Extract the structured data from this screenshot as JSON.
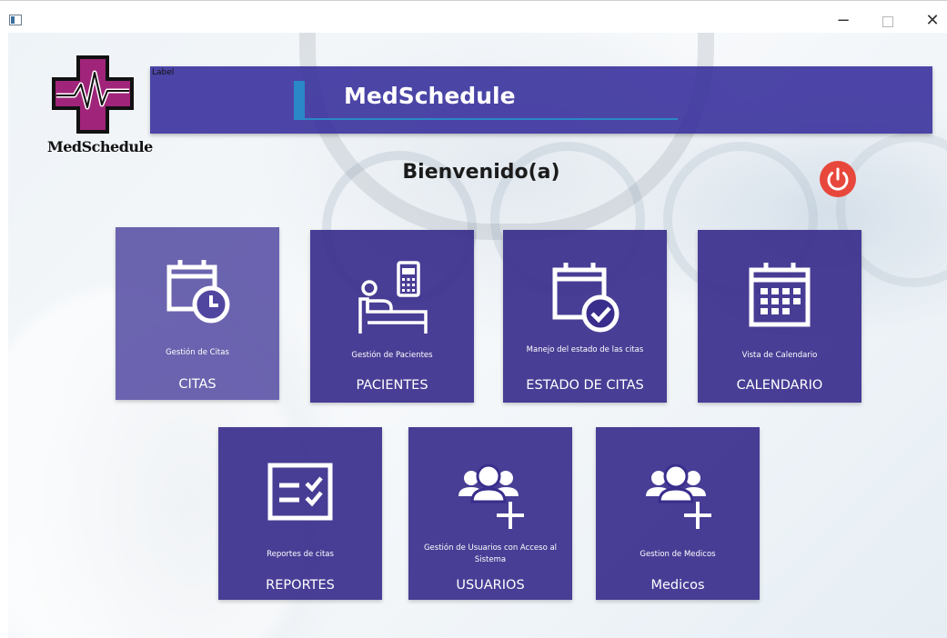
{
  "window": {
    "min_glyph": "−",
    "close_glyph": "✕"
  },
  "logo": {
    "text": "MedSchedule",
    "icon": "medical-cross-heartbeat-icon",
    "colors": {
      "outline": "#111111",
      "fill": "#a0247a"
    }
  },
  "header": {
    "label": "Label",
    "title": "MedSchedule"
  },
  "welcome": "Bienvenido(a)",
  "power_button": {
    "icon": "power-icon",
    "color": "#e8473c"
  },
  "tiles": [
    {
      "icon": "calendar-clock-icon",
      "description": "Gestión de Citas",
      "name": "CITAS"
    },
    {
      "icon": "patient-bed-icon",
      "description": "Gestión de Pacientes",
      "name": "PACIENTES"
    },
    {
      "icon": "calendar-check-icon",
      "description": "Manejo del estado de las citas",
      "name": "ESTADO DE CITAS"
    },
    {
      "icon": "calendar-grid-icon",
      "description": "Vista de Calendario",
      "name": "CALENDARIO"
    },
    {
      "icon": "checklist-icon",
      "description": "Reportes de citas",
      "name": "REPORTES"
    },
    {
      "icon": "users-add-icon",
      "description": "Gestión de Usuarios con Acceso al Sistema",
      "name": "USUARIOS"
    },
    {
      "icon": "users-add-icon",
      "description": "Gestion de Medicos",
      "name": "Medicos"
    }
  ]
}
